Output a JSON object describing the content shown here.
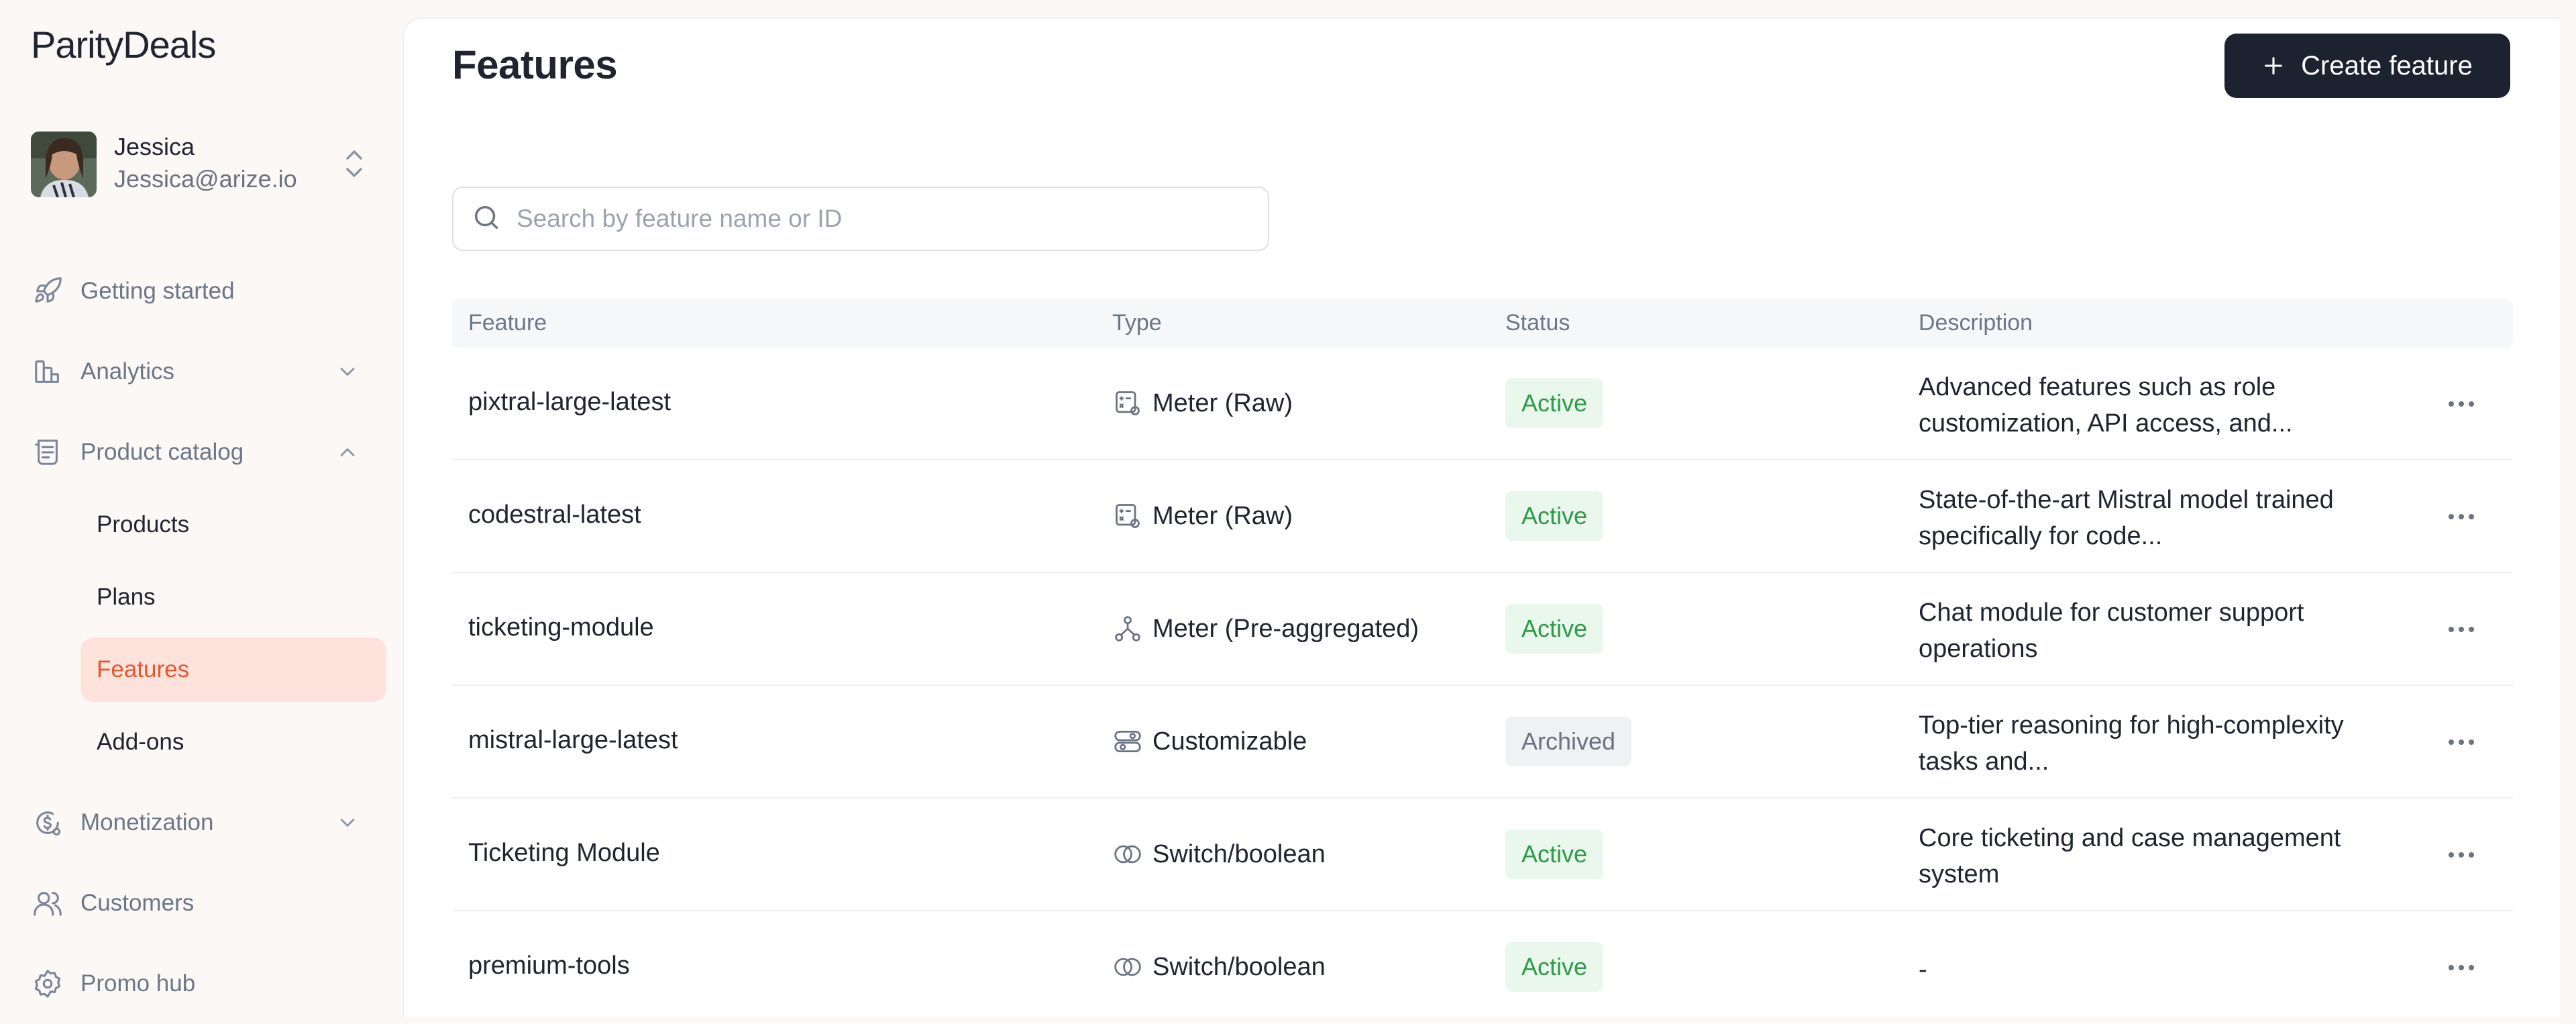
{
  "app": {
    "logo": "ParityDeals"
  },
  "user": {
    "name": "Jessica",
    "email": "Jessica@arize.io"
  },
  "sidebar": {
    "nav": [
      {
        "label": "Getting started",
        "icon": "rocket-icon"
      },
      {
        "label": "Analytics",
        "icon": "bar-chart-icon"
      },
      {
        "label": "Product catalog",
        "icon": "catalog-icon"
      },
      {
        "label": "Monetization",
        "icon": "dollar-gear-icon"
      },
      {
        "label": "Customers",
        "icon": "users-icon"
      },
      {
        "label": "Promo hub",
        "icon": "promo-badge-icon"
      }
    ],
    "sub": [
      {
        "label": "Products"
      },
      {
        "label": "Plans"
      },
      {
        "label": "Features",
        "active": true
      },
      {
        "label": "Add-ons"
      }
    ]
  },
  "header": {
    "title": "Features",
    "create_label": "Create feature"
  },
  "search": {
    "placeholder": "Search by feature name or ID",
    "value": ""
  },
  "table": {
    "columns": [
      "Feature",
      "Type",
      "Status",
      "Description"
    ],
    "rows": [
      {
        "feature": "pixtral-large-latest",
        "type": "Meter (Raw)",
        "type_icon": "meter-raw-icon",
        "status": "Active",
        "description": "Advanced features such as role customization, API access, and..."
      },
      {
        "feature": "codestral-latest",
        "type": "Meter (Raw)",
        "type_icon": "meter-raw-icon",
        "status": "Active",
        "description": "State-of-the-art Mistral model trained specifically for code..."
      },
      {
        "feature": "ticketing-module",
        "type": "Meter (Pre-aggregated)",
        "type_icon": "meter-aggregated-icon",
        "status": "Active",
        "description": "Chat module for customer support operations"
      },
      {
        "feature": "mistral-large-latest",
        "type": "Customizable",
        "type_icon": "customizable-icon",
        "status": "Archived",
        "description": "Top-tier reasoning for high-complexity tasks and..."
      },
      {
        "feature": "Ticketing Module",
        "type": "Switch/boolean",
        "type_icon": "switch-boolean-icon",
        "status": "Active",
        "description": "Core ticketing and case management system"
      },
      {
        "feature": "premium-tools",
        "type": "Switch/boolean",
        "type_icon": "switch-boolean-icon",
        "status": "Active",
        "description": "-"
      }
    ]
  },
  "colors": {
    "accent": "#e3572f",
    "accent_bg": "#fde3dc",
    "active_text": "#2f9a4a",
    "active_bg": "#e9f7ec",
    "archived_bg": "#f0f1f3",
    "button_bg": "#1c2230"
  }
}
